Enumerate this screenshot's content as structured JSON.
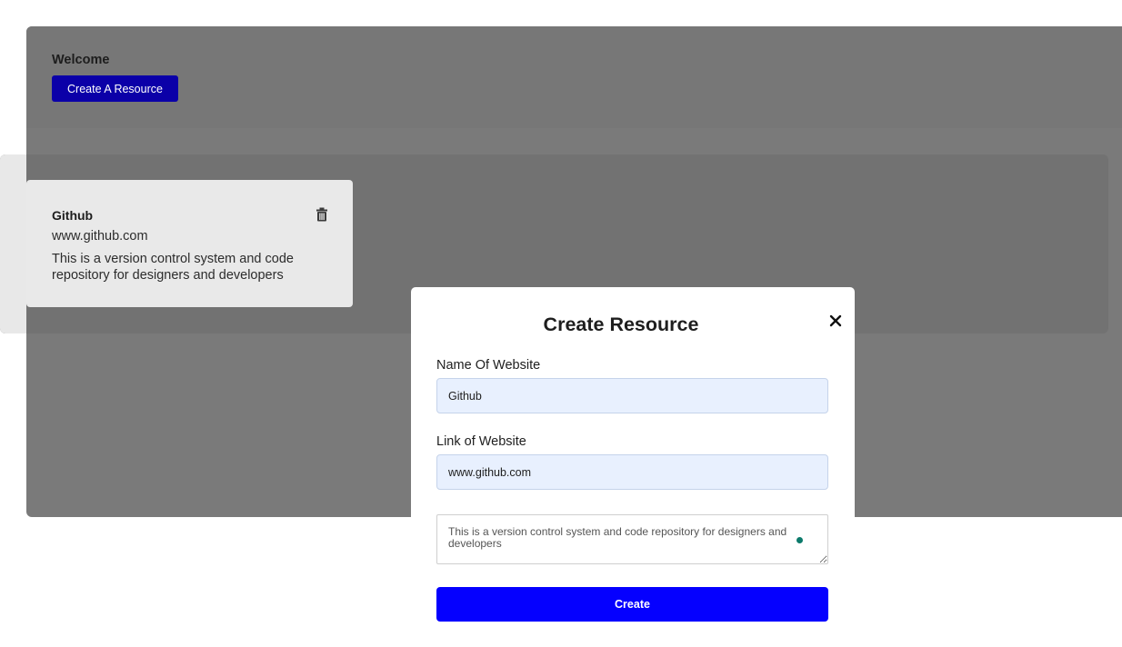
{
  "header": {
    "welcome_text": "Welcome",
    "create_button_label": "Create A Resource"
  },
  "resources": [
    {
      "name": "Github",
      "link": "www.github.com",
      "description": "This is a version control system and code repository for designers and developers",
      "delete_icon": "trash-icon"
    }
  ],
  "modal": {
    "title": "Create Resource",
    "close_icon": "close-icon",
    "name_label": "Name Of Website",
    "name_value": "Github",
    "link_label": "Link of Website",
    "link_value": "www.github.com",
    "description_value": "This is a version control system and code repository for designers and developers",
    "submit_label": "Create"
  },
  "colors": {
    "primary_button": "#0b00a8",
    "submit_button": "#0500ff",
    "overlay": "#7a7a7a",
    "input_fill": "#e8f0fe"
  }
}
